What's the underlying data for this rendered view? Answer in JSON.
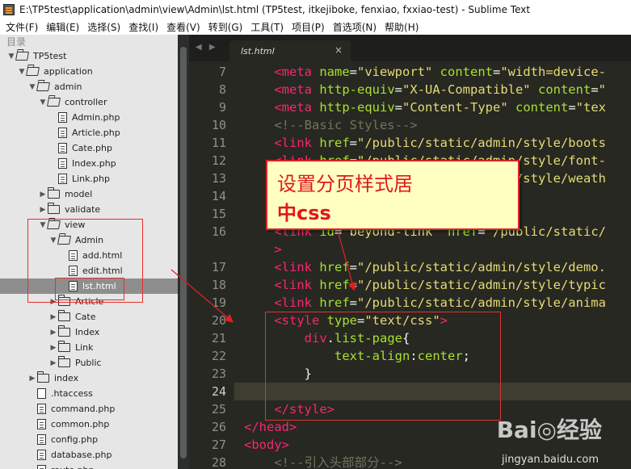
{
  "window": {
    "title": "E:\\TP5test\\application\\admin\\view\\Admin\\lst.html (TP5test, itkejiboke, fenxiao, fxxiao-test) - Sublime Text"
  },
  "menu": [
    "文件(F)",
    "编辑(E)",
    "选择(S)",
    "查找(I)",
    "查看(V)",
    "转到(G)",
    "工具(T)",
    "项目(P)",
    "首选项(N)",
    "帮助(H)"
  ],
  "sidebar": {
    "heading": "目录",
    "items": [
      {
        "label": "TP5test",
        "kind": "folder",
        "open": true,
        "depth": 0
      },
      {
        "label": "application",
        "kind": "folder",
        "open": true,
        "depth": 1
      },
      {
        "label": "admin",
        "kind": "folder",
        "open": true,
        "depth": 2
      },
      {
        "label": "controller",
        "kind": "folder",
        "open": true,
        "depth": 3
      },
      {
        "label": "Admin.php",
        "kind": "file",
        "depth": 4
      },
      {
        "label": "Article.php",
        "kind": "file",
        "depth": 4
      },
      {
        "label": "Cate.php",
        "kind": "file",
        "depth": 4
      },
      {
        "label": "Index.php",
        "kind": "file",
        "depth": 4
      },
      {
        "label": "Link.php",
        "kind": "file",
        "depth": 4
      },
      {
        "label": "model",
        "kind": "folder",
        "open": false,
        "depth": 3
      },
      {
        "label": "validate",
        "kind": "folder",
        "open": false,
        "depth": 3
      },
      {
        "label": "view",
        "kind": "folder",
        "open": true,
        "depth": 3
      },
      {
        "label": "Admin",
        "kind": "folder",
        "open": true,
        "depth": 4
      },
      {
        "label": "add.html",
        "kind": "file",
        "depth": 5
      },
      {
        "label": "edit.html",
        "kind": "file",
        "depth": 5
      },
      {
        "label": "lst.html",
        "kind": "file",
        "depth": 5,
        "selected": true
      },
      {
        "label": "Article",
        "kind": "folder",
        "open": false,
        "depth": 4
      },
      {
        "label": "Cate",
        "kind": "folder",
        "open": false,
        "depth": 4
      },
      {
        "label": "Index",
        "kind": "folder",
        "open": false,
        "depth": 4
      },
      {
        "label": "Link",
        "kind": "folder",
        "open": false,
        "depth": 4
      },
      {
        "label": "Public",
        "kind": "folder",
        "open": false,
        "depth": 4
      },
      {
        "label": "index",
        "kind": "folder",
        "open": false,
        "depth": 2
      },
      {
        "label": ".htaccess",
        "kind": "file",
        "plain": true,
        "depth": 2
      },
      {
        "label": "command.php",
        "kind": "file",
        "depth": 2
      },
      {
        "label": "common.php",
        "kind": "file",
        "depth": 2
      },
      {
        "label": "config.php",
        "kind": "file",
        "depth": 2
      },
      {
        "label": "database.php",
        "kind": "file",
        "depth": 2
      },
      {
        "label": "route.php",
        "kind": "file",
        "depth": 2
      }
    ]
  },
  "editor": {
    "tab_label": "lst.html",
    "tab_close": "×",
    "tab_nav": "◀ ▶",
    "lines": [
      {
        "n": "7",
        "tokens": [
          [
            "t",
            "    "
          ],
          [
            "tag",
            "<meta "
          ],
          [
            "attr",
            "name"
          ],
          [
            "t",
            "="
          ],
          [
            "str",
            "\"viewport\""
          ],
          [
            "t",
            " "
          ],
          [
            "attr",
            "content"
          ],
          [
            "t",
            "="
          ],
          [
            "str",
            "\"width=device-"
          ]
        ]
      },
      {
        "n": "8",
        "tokens": [
          [
            "t",
            "    "
          ],
          [
            "tag",
            "<meta "
          ],
          [
            "attr",
            "http-equiv"
          ],
          [
            "t",
            "="
          ],
          [
            "str",
            "\"X-UA-Compatible\""
          ],
          [
            "t",
            " "
          ],
          [
            "attr",
            "content"
          ],
          [
            "t",
            "="
          ],
          [
            "str",
            "\""
          ]
        ]
      },
      {
        "n": "9",
        "tokens": [
          [
            "t",
            "    "
          ],
          [
            "tag",
            "<meta "
          ],
          [
            "attr",
            "http-equiv"
          ],
          [
            "t",
            "="
          ],
          [
            "str",
            "\"Content-Type\""
          ],
          [
            "t",
            " "
          ],
          [
            "attr",
            "content"
          ],
          [
            "t",
            "="
          ],
          [
            "str",
            "\"tex"
          ]
        ]
      },
      {
        "n": "10",
        "tokens": [
          [
            "t",
            "    "
          ],
          [
            "cmt",
            "<!--Basic Styles-->"
          ]
        ]
      },
      {
        "n": "11",
        "tokens": [
          [
            "t",
            "    "
          ],
          [
            "tag",
            "<link "
          ],
          [
            "attr",
            "href"
          ],
          [
            "t",
            "="
          ],
          [
            "str",
            "\"/public/static/admin/style/boots"
          ]
        ]
      },
      {
        "n": "12",
        "tokens": [
          [
            "t",
            "    "
          ],
          [
            "tag",
            "<link "
          ],
          [
            "attr",
            "href"
          ],
          [
            "t",
            "="
          ],
          [
            "str",
            "\"/public/static/admin/style/font-"
          ]
        ]
      },
      {
        "n": "13",
        "tokens": [
          [
            "t",
            "    "
          ],
          [
            "tag",
            "<link "
          ],
          [
            "attr",
            "href"
          ],
          [
            "t",
            "="
          ],
          [
            "str",
            "\"/public/static/admin/style/weath"
          ]
        ]
      },
      {
        "n": "14",
        "tokens": [
          [
            "t",
            ""
          ]
        ]
      },
      {
        "n": "15",
        "tokens": [
          [
            "t",
            ""
          ]
        ]
      },
      {
        "n": "16",
        "tokens": [
          [
            "t",
            "    "
          ],
          [
            "tag",
            "<link "
          ],
          [
            "attr",
            "id"
          ],
          [
            "t",
            "="
          ],
          [
            "str",
            "\"beyond-link\""
          ],
          [
            "t",
            " "
          ],
          [
            "attr",
            "href"
          ],
          [
            "t",
            "="
          ],
          [
            "str",
            "\"/public/static/"
          ]
        ]
      },
      {
        "n": "",
        "tokens": [
          [
            "t",
            "    "
          ],
          [
            "tag",
            ">"
          ]
        ]
      },
      {
        "n": "17",
        "tokens": [
          [
            "t",
            "    "
          ],
          [
            "tag",
            "<link "
          ],
          [
            "attr",
            "href"
          ],
          [
            "t",
            "="
          ],
          [
            "str",
            "\"/public/static/admin/style/demo."
          ]
        ]
      },
      {
        "n": "18",
        "tokens": [
          [
            "t",
            "    "
          ],
          [
            "tag",
            "<link "
          ],
          [
            "attr",
            "href"
          ],
          [
            "t",
            "="
          ],
          [
            "str",
            "\"/public/static/admin/style/typic"
          ]
        ]
      },
      {
        "n": "19",
        "tokens": [
          [
            "t",
            "    "
          ],
          [
            "tag",
            "<link "
          ],
          [
            "attr",
            "href"
          ],
          [
            "t",
            "="
          ],
          [
            "str",
            "\"/public/static/admin/style/anima"
          ]
        ]
      },
      {
        "n": "20",
        "tokens": [
          [
            "t",
            "    "
          ],
          [
            "tag",
            "<style "
          ],
          [
            "attr",
            "type"
          ],
          [
            "t",
            "="
          ],
          [
            "str",
            "\"text/css\""
          ],
          [
            "tag",
            ">"
          ]
        ]
      },
      {
        "n": "21",
        "tokens": [
          [
            "t",
            "        "
          ],
          [
            "tag",
            "div"
          ],
          [
            "t",
            "."
          ],
          [
            "attr",
            "list-page"
          ],
          [
            "t",
            "{"
          ]
        ]
      },
      {
        "n": "22",
        "tokens": [
          [
            "t",
            "            "
          ],
          [
            "attr",
            "text-align"
          ],
          [
            "t",
            ":"
          ],
          [
            "attr",
            "center"
          ],
          [
            "t",
            ";"
          ]
        ]
      },
      {
        "n": "23",
        "tokens": [
          [
            "t",
            "        }"
          ]
        ]
      },
      {
        "n": "24",
        "tokens": [
          [
            "t",
            ""
          ]
        ],
        "current": true
      },
      {
        "n": "25",
        "tokens": [
          [
            "t",
            "    "
          ],
          [
            "tag",
            "</style>"
          ]
        ]
      },
      {
        "n": "26",
        "tokens": [
          [
            "tag",
            "</head>"
          ]
        ]
      },
      {
        "n": "27",
        "tokens": [
          [
            "tag",
            "<body>"
          ]
        ]
      },
      {
        "n": "28",
        "tokens": [
          [
            "t",
            "    "
          ],
          [
            "cmt",
            "<!--引入头部部分-->"
          ]
        ]
      }
    ]
  },
  "annotation": {
    "callout_line1": "设置分页样式居",
    "callout_line2": "中css"
  },
  "watermark": {
    "brand": "Bai◎经验",
    "url": "jingyan.baidu.com"
  },
  "colors": {
    "editor_bg": "#272822",
    "tag": "#f92672",
    "attr": "#a6e22e",
    "string": "#e6db74",
    "comment": "#75715e",
    "annotation_red": "#e53030",
    "callout_bg": "#ffffc2"
  }
}
